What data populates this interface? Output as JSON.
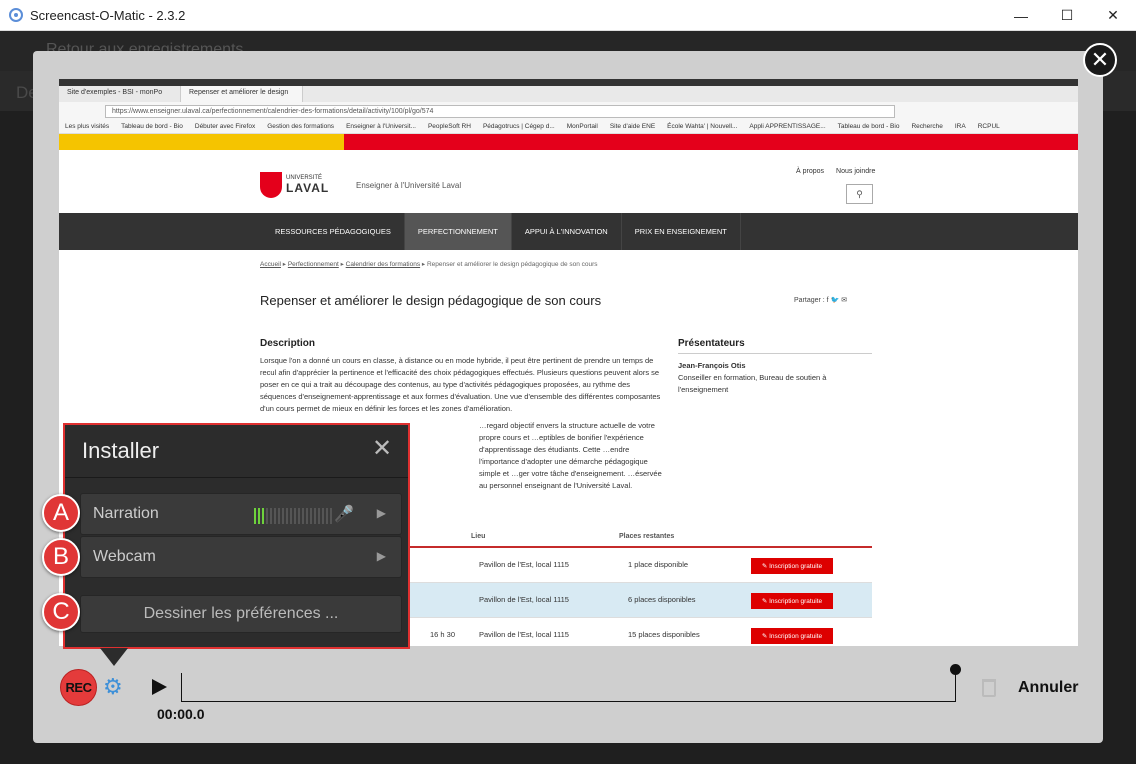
{
  "window": {
    "title": "Screencast-O-Matic - 2.3.2",
    "minimize": "—",
    "maximize": "☐",
    "close": "✕"
  },
  "background": {
    "top_text": "Retour aux enregistrements",
    "sub_text": "De"
  },
  "browser": {
    "tabs": [
      "Site d'exemples - BSI - monPo",
      "Repenser et améliorer le design"
    ],
    "url": "https://www.enseigner.ulaval.ca/perfectionnement/calendrier-des-formations/detail/activity/100/pl/go/574",
    "bookmarks": [
      "Les plus visités",
      "Tableau de bord - Bio",
      "Débuter avec Firefox",
      "Gestion des formations",
      "Enseigner à l'Universit...",
      "PeopleSoft RH",
      "Pédagotrucs | Cégep d...",
      "MonPortail",
      "Site d'aide ENE",
      "École Wahta' | Nouvell...",
      "Appli APPRENTISSAGE...",
      "Tableau de bord - Bio",
      "Recherche",
      "IRA",
      "RCPUL"
    ]
  },
  "site": {
    "university_small": "UNIVERSITÉ",
    "university_big": "LAVAL",
    "subbrand": "Enseigner à l'Université Laval",
    "top_links": [
      "À propos",
      "Nous joindre"
    ],
    "search_icon": "⚲",
    "nav": [
      "RESSOURCES PÉDAGOGIQUES",
      "PERFECTIONNEMENT",
      "APPUI À L'INNOVATION",
      "PRIX EN ENSEIGNEMENT"
    ],
    "breadcrumb": [
      "Accueil",
      "Perfectionnement",
      "Calendrier des formations",
      "Repenser et améliorer le design pédagogique de son cours"
    ],
    "page_title": "Repenser et améliorer le design pédagogique de son cours",
    "share": "Partager :  f  🐦  ✉",
    "description_heading": "Description",
    "description": "Lorsque l'on a donné un cours en classe, à distance ou en mode hybride, il peut être pertinent de prendre un temps de recul afin d'apprécier la pertinence et l'efficacité des choix pédagogiques effectués. Plusieurs questions peuvent alors se poser en ce qui a trait au découpage des contenus, au type d'activités pédagogiques proposées, au rythme des séquences d'enseignement-apprentissage et aux formes d'évaluation. Une vue d'ensemble des différentes composantes d'un cours permet de mieux en définir les forces et les zones d'amélioration.",
    "description2": "…regard objectif envers la structure actuelle de votre propre cours et …eptibles de bonifier l'expérience d'apprentissage des étudiants. Cette …endre l'importance d'adopter une démarche pédagogique simple et …ger votre tâche d'enseignement. …éservée au personnel enseignant de l'Université Laval.",
    "presenters_heading": "Présentateurs",
    "presenter_name": "Jean-François Otis",
    "presenter_role": "Conseiller en formation, Bureau de soutien à l'enseignement",
    "table_headers": [
      "Lieu",
      "Places restantes"
    ],
    "rows": [
      {
        "time": "",
        "place": "Pavillon de l'Est, local 1115",
        "spots": "1 place disponible",
        "button": "✎ Inscription gratuite"
      },
      {
        "time": "",
        "place": "Pavillon de l'Est, local 1115",
        "spots": "6 places disponibles",
        "button": "✎ Inscription gratuite"
      },
      {
        "time": "16 h 30",
        "place": "Pavillon de l'Est, local 1115",
        "spots": "15 places disponibles",
        "button": "✎ Inscription gratuite"
      }
    ]
  },
  "installer": {
    "title": "Installer",
    "close": "✕",
    "narration": "Narration",
    "webcam": "Webcam",
    "draw_prefs": "Dessiner les préférences ...",
    "mic_level": 0.15,
    "arrow": "▶",
    "mic_icon": "🎤"
  },
  "badges": {
    "a": "A",
    "b": "B",
    "c": "C"
  },
  "controls": {
    "rec": "REC",
    "time": "00:00.0",
    "cancel": "Annuler",
    "gear": "⚙",
    "close_modal": "✕"
  }
}
